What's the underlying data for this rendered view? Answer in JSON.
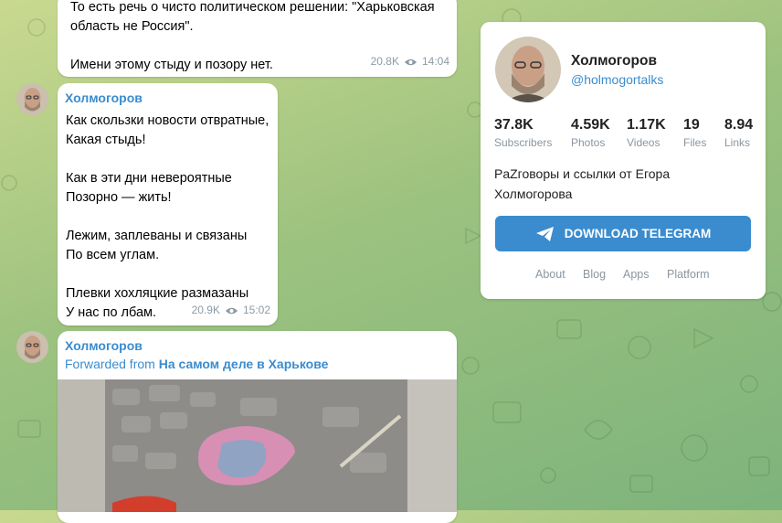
{
  "messages": [
    {
      "text": "То есть речь о чисто политическом решении: \"Харьковская область не Россия\".\n\nИмени этому стыду и позору нет.",
      "views": "20.8K",
      "time": "14:04"
    },
    {
      "author": "Холмогоров",
      "text": "Как скользки новости отвратные,\nКакая стыдь!\n\nКак в эти дни невероятные\nПозорно — жить!\n\nЛежим, заплеваны и связаны\nПо всем углам.\n\nПлевки хохляцкие размазаны\nУ нас по лбам.",
      "views": "20.9K",
      "time": "15:02"
    },
    {
      "author": "Холмогоров",
      "forwarded_prefix": "Forwarded from",
      "forwarded_source": "На самом деле в Харькове"
    }
  ],
  "channel": {
    "name": "Холмогоров",
    "handle": "@holmogortalks",
    "stats": [
      {
        "value": "37.8K",
        "label": "Subscribers"
      },
      {
        "value": "4.59K",
        "label": "Photos"
      },
      {
        "value": "1.17K",
        "label": "Videos"
      },
      {
        "value": "19",
        "label": "Files"
      },
      {
        "value": "8.94",
        "label": "Links"
      }
    ],
    "description": "PaZговоры и ссылки от Егора Холмогорова",
    "download_label": "DOWNLOAD TELEGRAM",
    "footer_links": [
      "About",
      "Blog",
      "Apps",
      "Platform"
    ]
  },
  "colors": {
    "accent": "#3a8ccf",
    "meta": "#8c9aa5"
  }
}
